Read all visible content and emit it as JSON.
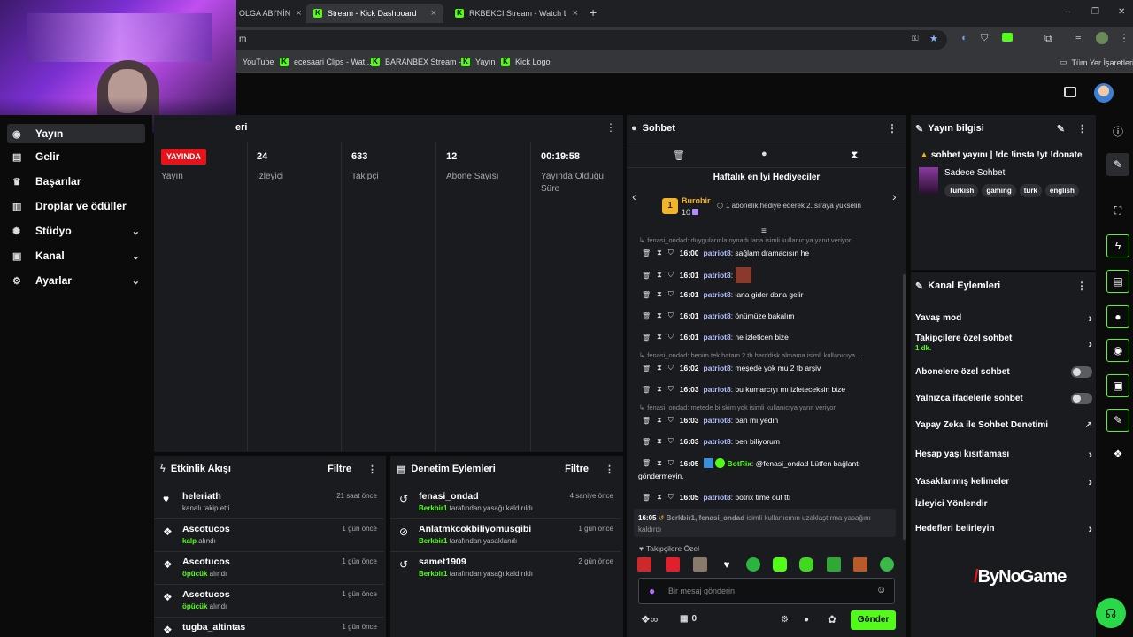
{
  "browser": {
    "tabs": [
      {
        "label": "OLGA ABİ'NİN",
        "close": "×"
      },
      {
        "label": "Stream - Kick Dashboard",
        "close": "×"
      },
      {
        "label": "RKBEKCI Stream - Watch Live o",
        "close": "×"
      }
    ],
    "new_tab": "+",
    "window_controls": {
      "min": "–",
      "max": "❐",
      "close": "✕"
    },
    "url": "m",
    "bookmarks": [
      "YouTube",
      "ecesaari Clips - Wat...",
      "BARANBEX Stream -...",
      "Yayın",
      "Kick Logo"
    ],
    "all_bookmarks": "Tüm Yer İşaretleri"
  },
  "sidebar": {
    "items": [
      {
        "label": "Yayın",
        "icon": "broadcast-icon"
      },
      {
        "label": "Gelir",
        "icon": "revenue-icon"
      },
      {
        "label": "Başarılar",
        "icon": "trophy-icon"
      },
      {
        "label": "Droplar ve ödüller",
        "icon": "gift-icon"
      },
      {
        "label": "Stüdyo",
        "icon": "studio-icon",
        "chevron": true
      },
      {
        "label": "Kanal",
        "icon": "channel-icon",
        "chevron": true
      },
      {
        "label": "Ayarlar",
        "icon": "gear-icon",
        "chevron": true
      }
    ]
  },
  "stats": {
    "header_fragment": "eri",
    "live_badge": "YAYINDA",
    "live_label": "Yayın",
    "viewers": {
      "value": "24",
      "label": "İzleyici"
    },
    "followers": {
      "value": "633",
      "label": "Takipçi"
    },
    "subs": {
      "value": "12",
      "label": "Abone Sayısı"
    },
    "uptime": {
      "value": "00:19:58",
      "label": "Yayında Olduğu Süre"
    }
  },
  "activity": {
    "title": "Etkinlik Akışı",
    "filter": "Filtre",
    "rows": [
      {
        "name": "heleriath",
        "sub_pre": "",
        "sub_hl": "",
        "sub_post": "kanalı takip etti",
        "time": "21 saat önce",
        "icon": "heart-icon"
      },
      {
        "name": "Ascotucos",
        "sub_pre": "",
        "sub_hl": "kalp",
        "sub_post": " alındı",
        "time": "1 gün önce",
        "icon": "gift-icon"
      },
      {
        "name": "Ascotucos",
        "sub_pre": "",
        "sub_hl": "öpücük",
        "sub_post": " alındı",
        "time": "1 gün önce",
        "icon": "gift-icon"
      },
      {
        "name": "Ascotucos",
        "sub_pre": "",
        "sub_hl": "öpücük",
        "sub_post": " alındı",
        "time": "1 gün önce",
        "icon": "gift-icon"
      },
      {
        "name": "tugba_altintas",
        "sub_pre": "",
        "sub_hl": "",
        "sub_post": "",
        "time": "1 gün önce",
        "icon": "gift-icon"
      }
    ]
  },
  "moderation": {
    "title": "Denetim Eylemleri",
    "filter": "Filtre",
    "rows": [
      {
        "name": "fenasi_ondad",
        "hl": "Berkbir1",
        "post": " tarafından yasağı kaldırıldı",
        "time": "4 saniye önce",
        "icon": "undo-icon"
      },
      {
        "name": "Anlatmkcokbiliyomusgibi",
        "hl": "Berkbir1",
        "post": " tarafından yasaklandı",
        "time": "1 gün önce",
        "icon": "ban-icon"
      },
      {
        "name": "samet1909",
        "hl": "Berkbir1",
        "post": " tarafından yasağı kaldırıldı",
        "time": "2 gün önce",
        "icon": "undo-icon"
      }
    ]
  },
  "chat": {
    "title": "Sohbet",
    "weekly_title": "Haftalık en İyi Hediyeciler",
    "top_gifter": {
      "rank": "1",
      "name": "Burobir",
      "count": "10"
    },
    "gifter_hint": "1 abonelik hediye ederek 2. sıraya yükselin",
    "lines": [
      {
        "kind": "sys",
        "text": "fenasi_ondad: duygularınla oynadı lana isimli kullanıcıya yanıt veriyor"
      },
      {
        "kind": "msg",
        "time": "16:00",
        "user": "patriot8",
        "text": ": sağlam dramacısın he"
      },
      {
        "kind": "msg",
        "time": "16:01",
        "user": "patriot8",
        "text": ":"
      },
      {
        "kind": "msg",
        "time": "16:01",
        "user": "patriot8",
        "text": ": lana gider dana gelir"
      },
      {
        "kind": "msg",
        "time": "16:01",
        "user": "patriot8",
        "text": ": önümüze bakalım"
      },
      {
        "kind": "msg",
        "time": "16:01",
        "user": "patriot8",
        "text": ": ne izleticen bize"
      },
      {
        "kind": "sys",
        "text": "fenasi_ondad: benim tek hatam 2 tb harddisk almama isimli kullanıcıya ..."
      },
      {
        "kind": "msg",
        "time": "16:02",
        "user": "patriot8",
        "text": ": meşede yok mu 2 tb arşiv"
      },
      {
        "kind": "msg",
        "time": "16:03",
        "user": "patriot8",
        "text": ": bu kumarcıyı mı izleteceksin bize"
      },
      {
        "kind": "sys",
        "text": "fenasi_ondad: metede bi skim yok isimli kullanıcıya yanıt veriyor"
      },
      {
        "kind": "msg",
        "time": "16:03",
        "user": "patriot8",
        "text": ": ban mı yedin"
      },
      {
        "kind": "msg",
        "time": "16:03",
        "user": "patriot8",
        "text": ": ben biliyorum"
      }
    ],
    "botrix": {
      "time": "16:05",
      "user": "BotRix",
      "text": ": @fenasi_ondad Lütfen bağlantı",
      "cont": "göndermeyin."
    },
    "last": {
      "time": "16:05",
      "user": "patriot8",
      "text": ": botrix time out ttı"
    },
    "notice": {
      "time": "16:05",
      "users": "Berkbir1, fenasi_ondad",
      "text": " isimli kullanıcının uzaklaştırma yasağını",
      "cont": "kaldırdı"
    },
    "followers_only": "Takipçilere Özel",
    "input_placeholder": "Bir mesaj gönderin",
    "points": "0",
    "send": "Gönder"
  },
  "stream_info": {
    "title": "Yayın bilgisi",
    "stream_title": "sohbet yayını | !dc !insta !yt !donate",
    "category": "Sadece Sohbet",
    "tags": [
      "Turkish",
      "gaming",
      "turk",
      "english"
    ]
  },
  "channel_actions": {
    "title": "Kanal Eylemleri",
    "items": [
      {
        "label": "Yavaş mod",
        "type": "chevron"
      },
      {
        "label": "Takipçilere özel sohbet",
        "sub": "1 dk.",
        "type": "chevron"
      },
      {
        "label": "Abonelere özel sohbet",
        "type": "toggle"
      },
      {
        "label": "Yalnızca ifadelerle sohbet",
        "type": "toggle"
      },
      {
        "label": "Yapay Zeka ile Sohbet Denetimi",
        "type": "external"
      },
      {
        "label": "Hesap yaşı kısıtlaması",
        "type": "chevron"
      },
      {
        "label": "Yasaklanmış kelimeler",
        "type": "chevron"
      },
      {
        "label": "İzleyici Yönlendir",
        "type": "none"
      },
      {
        "label": "Hedefleri belirleyin",
        "type": "chevron"
      }
    ]
  },
  "watermark": "ByNoGame",
  "colors": {
    "accent": "#53fc18",
    "live": "#e5141c",
    "panel": "#191b1f"
  }
}
